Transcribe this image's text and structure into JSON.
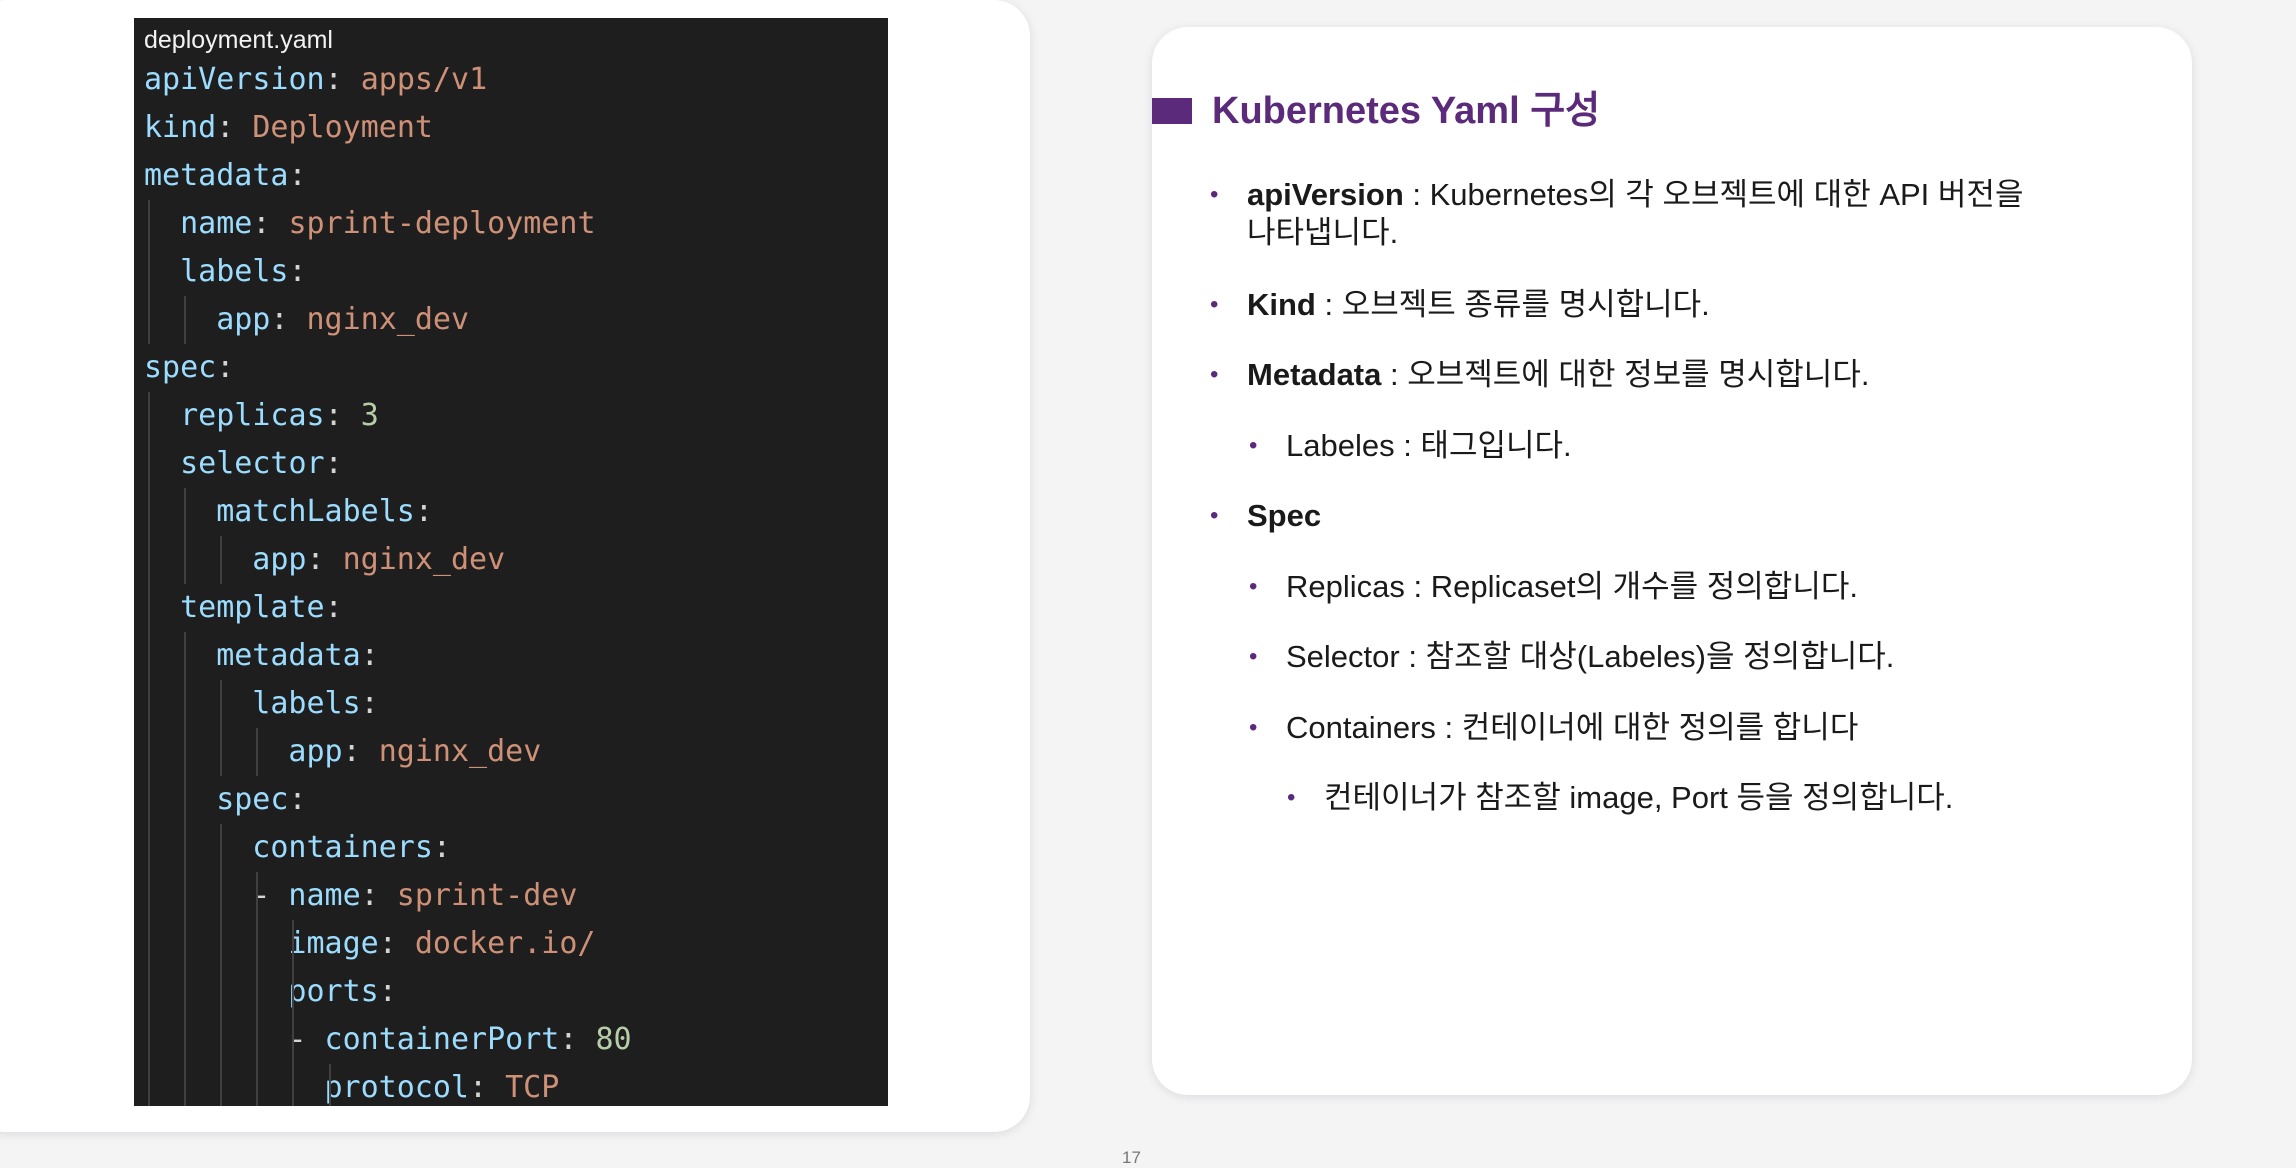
{
  "code": {
    "filename": "deployment.yaml",
    "lines": [
      {
        "key": "apiVersion",
        "val": "apps/v1",
        "type": "str"
      },
      {
        "key": "kind",
        "val": "Deployment",
        "type": "str"
      },
      {
        "key": "metadata",
        "val": "",
        "type": ""
      },
      {
        "key": "name",
        "val": "sprint-deployment",
        "type": "str"
      },
      {
        "key": "labels",
        "val": "",
        "type": ""
      },
      {
        "key": "app",
        "val": "nginx_dev",
        "type": "str"
      },
      {
        "key": "spec",
        "val": "",
        "type": ""
      },
      {
        "key": "replicas",
        "val": "3",
        "type": "num"
      },
      {
        "key": "selector",
        "val": "",
        "type": ""
      },
      {
        "key": "matchLabels",
        "val": "",
        "type": ""
      },
      {
        "key": "app",
        "val": "nginx_dev",
        "type": "str"
      },
      {
        "key": "template",
        "val": "",
        "type": ""
      },
      {
        "key": "metadata",
        "val": "",
        "type": ""
      },
      {
        "key": "labels",
        "val": "",
        "type": ""
      },
      {
        "key": "app",
        "val": "nginx_dev",
        "type": "str"
      },
      {
        "key": "spec",
        "val": "",
        "type": ""
      },
      {
        "key": "containers",
        "val": "",
        "type": ""
      },
      {
        "key": "name",
        "val": "sprint-dev",
        "type": "str",
        "dash": true
      },
      {
        "key": "image",
        "val": "docker.io/",
        "type": "str"
      },
      {
        "key": "ports",
        "val": "",
        "type": ""
      },
      {
        "key": "containerPort",
        "val": "80",
        "type": "num",
        "dash": true
      },
      {
        "key": "protocol",
        "val": "TCP",
        "type": "str"
      }
    ]
  },
  "slide": {
    "title": "Kubernetes Yaml 구성",
    "bullets": [
      {
        "bold": "apiVersion",
        "text": " : Kubernetes의 각 오브젝트에 대한 API 버전을",
        "cont": "나타냅니다."
      },
      {
        "bold": "Kind",
        "text": " : 오브젝트 종류를 명시합니다."
      },
      {
        "bold": "Metadata",
        "text": " : 오브젝트에 대한 정보를 명시합니다."
      },
      {
        "bold": "",
        "text": "Labeles : 태그입니다."
      },
      {
        "bold": "Spec",
        "text": ""
      },
      {
        "bold": "",
        "text": "Replicas : Replicaset의 개수를 정의합니다."
      },
      {
        "bold": "",
        "text": "Selector : 참조할 대상(Labeles)을 정의합니다."
      },
      {
        "bold": "",
        "text": "Containers : 컨테이너에 대한 정의를 합니다"
      },
      {
        "bold": "",
        "text": "컨테이너가 참조할 image, Port 등을 정의합니다."
      }
    ]
  },
  "page_number": "17",
  "colors": {
    "accent": "#5b2a7a",
    "code_bg": "#1e1e1e",
    "key": "#9cdcfe",
    "string": "#ce9178",
    "number": "#b5cea8"
  }
}
